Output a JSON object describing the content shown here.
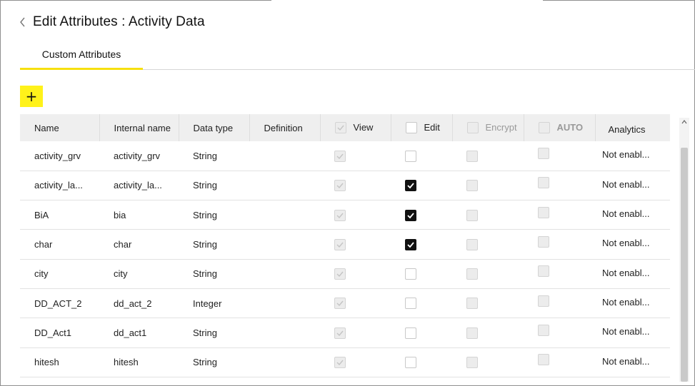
{
  "header": {
    "title": "Edit Attributes : Activity Data"
  },
  "tabs": [
    {
      "label": "Custom Attributes"
    }
  ],
  "toolbar": {
    "add_label": "+"
  },
  "table": {
    "columns": {
      "name": "Name",
      "internal_name": "Internal name",
      "data_type": "Data type",
      "definition": "Definition",
      "view": "View",
      "edit": "Edit",
      "encrypt": "Encrypt",
      "auto": "AUTO",
      "analytics": "Analytics"
    },
    "rows": [
      {
        "name": "activity_grv",
        "internal_name": "activity_grv",
        "data_type": "String",
        "definition": "",
        "view": true,
        "edit": false,
        "encrypt": false,
        "auto": false,
        "analytics": "Not enabl..."
      },
      {
        "name": "activity_la...",
        "internal_name": "activity_la...",
        "data_type": "String",
        "definition": "",
        "view": true,
        "edit": true,
        "encrypt": false,
        "auto": false,
        "analytics": "Not enabl..."
      },
      {
        "name": "BiA",
        "internal_name": "bia",
        "data_type": "String",
        "definition": "",
        "view": true,
        "edit": true,
        "encrypt": false,
        "auto": false,
        "analytics": "Not enabl..."
      },
      {
        "name": "char",
        "internal_name": "char",
        "data_type": "String",
        "definition": "",
        "view": true,
        "edit": true,
        "encrypt": false,
        "auto": false,
        "analytics": "Not enabl..."
      },
      {
        "name": "city",
        "internal_name": "city",
        "data_type": "String",
        "definition": "",
        "view": true,
        "edit": false,
        "encrypt": false,
        "auto": false,
        "analytics": "Not enabl..."
      },
      {
        "name": "DD_ACT_2",
        "internal_name": "dd_act_2",
        "data_type": "Integer",
        "definition": "",
        "view": true,
        "edit": false,
        "encrypt": false,
        "auto": false,
        "analytics": "Not enabl..."
      },
      {
        "name": "DD_Act1",
        "internal_name": "dd_act1",
        "data_type": "String",
        "definition": "",
        "view": true,
        "edit": false,
        "encrypt": false,
        "auto": false,
        "analytics": "Not enabl..."
      },
      {
        "name": "hitesh",
        "internal_name": "hitesh",
        "data_type": "String",
        "definition": "",
        "view": true,
        "edit": false,
        "encrypt": false,
        "auto": false,
        "analytics": "Not enabl..."
      }
    ]
  },
  "colors": {
    "accent": "#f6e00f",
    "add_button": "#fff21a",
    "header_bg": "#efefef"
  }
}
